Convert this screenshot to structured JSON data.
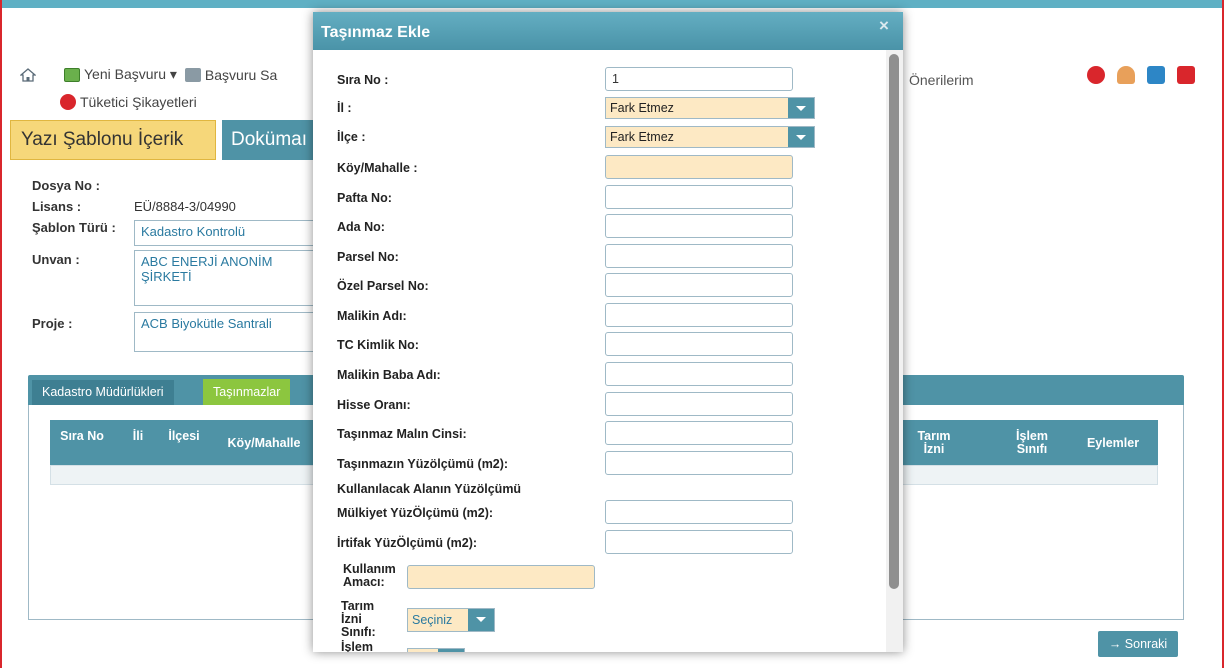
{
  "nav": {
    "yeni_basvuru": "Yeni Başvuru ▾",
    "basvuru_sa": "Başvuru Sa",
    "onerilerim": "Önerilerim",
    "tuketici": "Tüketici Şikayetleri"
  },
  "tabs": {
    "yazi": "Yazı Şablonu İçerik",
    "dokuman": "Dokümaı"
  },
  "info": {
    "dosya_no_label": "Dosya No :",
    "lisans_label": "Lisans :",
    "lisans_value": "EÜ/8884-3/04990",
    "sablon_label": "Şablon Türü :",
    "sablon_value": "Kadastro Kontrolü",
    "unvan_label": "Unvan :",
    "unvan_value": "ABC ENERJİ ANONİM ŞİRKETİ",
    "proje_label": "Proje :",
    "proje_value": "ACB Biyokütle Santrali"
  },
  "subtabs": {
    "kadastro": "Kadastro Müdürlükleri",
    "tasinmazlar": "Taşınmazlar"
  },
  "table_headers": [
    "Sıra No",
    "İli",
    "İlçesi",
    "Köy/Mahalle",
    "Tarım İzni",
    "İşlem Sınıfı",
    "Eylemler"
  ],
  "sonraki": "→ Sonraki",
  "modal": {
    "title": "Taşınmaz Ekle",
    "close": "×",
    "fields": {
      "sira_no_label": "Sıra No :",
      "sira_no_value": "1",
      "il_label": "İl :",
      "il_value": "Fark Etmez",
      "ilce_label": "İlçe :",
      "ilce_value": "Fark Etmez",
      "koy_label": "Köy/Mahalle :",
      "pafta_label": "Pafta No:",
      "ada_label": "Ada No:",
      "parsel_label": "Parsel No:",
      "ozel_parsel_label": "Özel Parsel No:",
      "malikin_adi_label": "Malikin Adı:",
      "tc_label": "TC Kimlik No:",
      "baba_adi_label": "Malikin Baba Adı:",
      "hisse_label": "Hisse Oranı:",
      "cinsi_label": "Taşınmaz Malın Cinsi:",
      "yuzolcumu_label": "Taşınmazın Yüzölçümü (m2):",
      "kullanilacak_label": "Kullanılacak Alanın Yüzölçümü",
      "mulkiyet_label": "Mülkiyet YüzÖlçümü (m2):",
      "irtifak_label": "İrtifak YüzÖlçümü (m2):",
      "kullanim_label_1": "Kullanım",
      "kullanim_label_2": "Amacı:",
      "tarim_label_1": "Tarım",
      "tarim_label_2": "İzni",
      "tarim_label_3": "Sınıfı:",
      "tarim_value": "Seçiniz",
      "islem_label": "İşlem"
    }
  }
}
